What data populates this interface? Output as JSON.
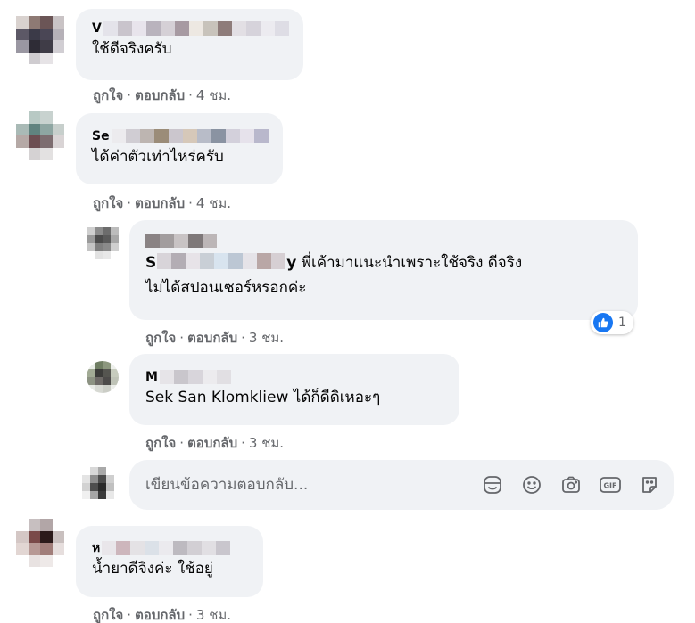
{
  "colors": {
    "bubble_bg": "#f0f2f5",
    "meta_text": "#65676b",
    "like_blue": "#1877f2"
  },
  "actions": {
    "like": "ถูกใจ",
    "reply": "ตอบกลับ",
    "dot": "·"
  },
  "comments": [
    {
      "author_visible": "V",
      "text": "ใช้ดีจริงครับ",
      "time": "4 ชม."
    },
    {
      "author_visible": "Se",
      "text": "ได้ค่าตัวเท่าไหร่ครับ",
      "time": "4 ชม."
    },
    {
      "author_visible": "",
      "mention_visible": "S",
      "mention_tail": "y",
      "text_line1": "พี่เค้ามาแนะนำเพราะใช้จริง ดีจริง",
      "text_line2": "ไม่ได้สปอนเซอร์หรอกค่ะ",
      "time": "3 ชม.",
      "reaction_icon": "like-icon",
      "reaction_count": "1"
    },
    {
      "author_visible": "M",
      "text": "Sek San Klomkliew ได้ก็ดีดิเหอะๆ",
      "time": "3 ชม."
    },
    {
      "author_visible": "ห",
      "text": "น้ำยาดีจิงค่ะ ใช้อยู่",
      "time": "3 ชม."
    }
  ],
  "composer": {
    "placeholder": "เขียนข้อความตอบกลับ...",
    "icons": [
      "sticker-icon",
      "emoji-icon",
      "camera-icon",
      "gif-icon",
      "sticker-outline-icon"
    ]
  }
}
